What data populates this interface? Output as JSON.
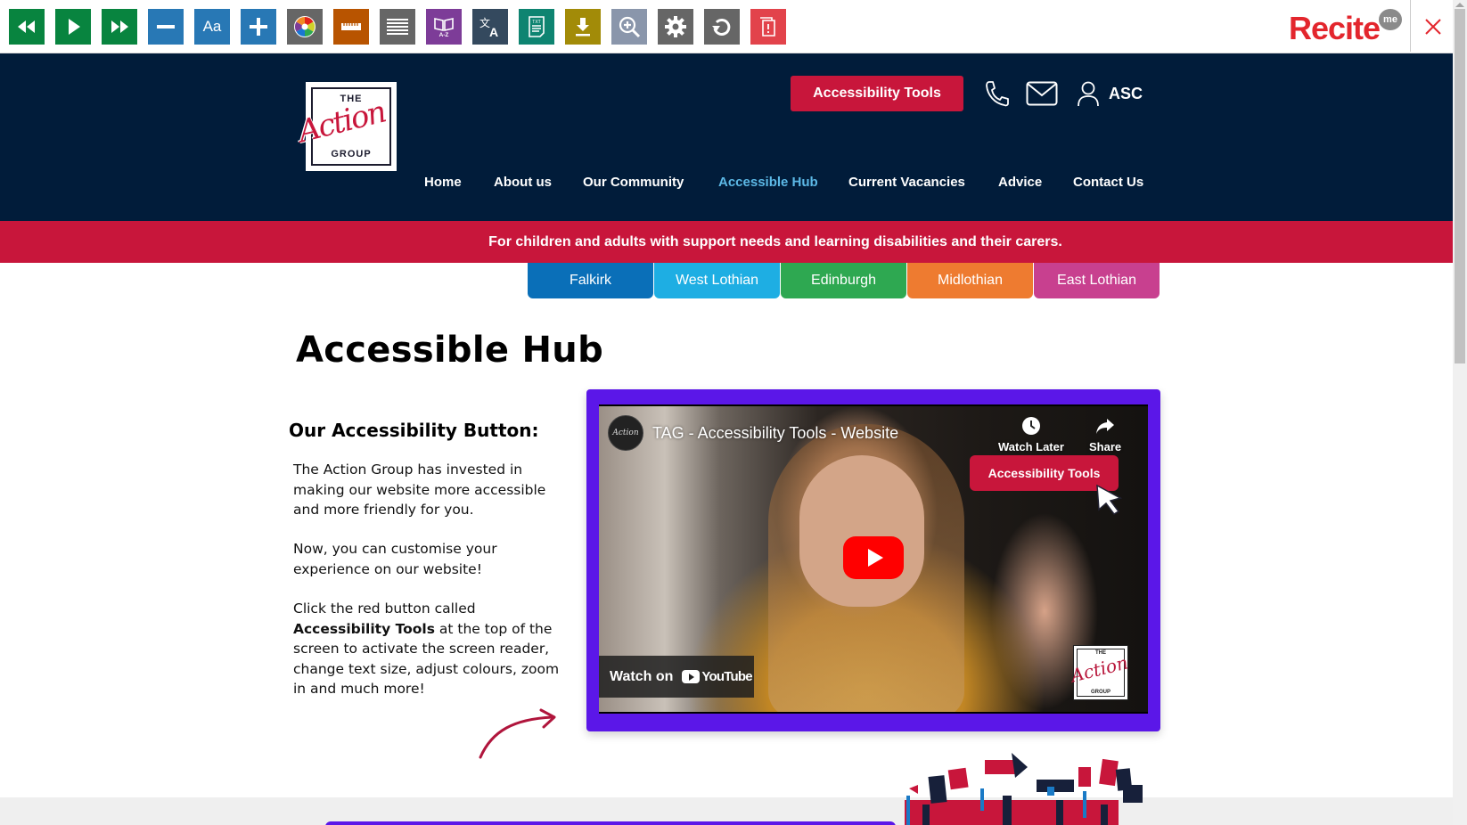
{
  "recite_toolbar": {
    "tools": [
      {
        "name": "rewind",
        "icon": "rewind-icon",
        "color": "#08843f"
      },
      {
        "name": "play",
        "icon": "play-icon",
        "color": "#08843f"
      },
      {
        "name": "fast-forward",
        "icon": "fast-forward-icon",
        "color": "#08843f"
      },
      {
        "name": "decrease-text",
        "icon": "minus-icon",
        "color": "#2878b5"
      },
      {
        "name": "font",
        "icon": "font-icon",
        "label": "Aa",
        "color": "#2878b5"
      },
      {
        "name": "increase-text",
        "icon": "plus-icon",
        "color": "#2878b5"
      },
      {
        "name": "colour",
        "icon": "colour-wheel-icon",
        "color": "#666666"
      },
      {
        "name": "ruler",
        "icon": "ruler-icon",
        "color": "#b85400"
      },
      {
        "name": "screen-mask",
        "icon": "screen-mask-icon",
        "color": "#666666"
      },
      {
        "name": "dictionary",
        "icon": "dictionary-icon",
        "label": "A-Z",
        "color": "#7d3c98"
      },
      {
        "name": "translate",
        "icon": "translate-icon",
        "color": "#34495e"
      },
      {
        "name": "text-only",
        "icon": "text-only-icon",
        "label": "TXT",
        "color": "#0e8471"
      },
      {
        "name": "download",
        "icon": "download-icon",
        "color": "#a28b08"
      },
      {
        "name": "magnifier",
        "icon": "magnifier-icon",
        "color": "#8a96ab"
      },
      {
        "name": "settings",
        "icon": "gear-icon",
        "color": "#666666"
      },
      {
        "name": "reset",
        "icon": "reset-icon",
        "color": "#666666"
      },
      {
        "name": "report",
        "icon": "report-icon",
        "color": "#e2434b"
      }
    ],
    "logo_text": "Recite",
    "logo_badge": "me",
    "close_icon": "close-icon"
  },
  "header": {
    "logo": {
      "top": "THE",
      "script": "Action",
      "bottom": "GROUP"
    },
    "accessibility_button": "Accessibility Tools",
    "phone_icon": "phone-icon",
    "mail_icon": "mail-icon",
    "user_icon": "user-icon",
    "account_label": "ASC",
    "nav": [
      {
        "label": "Home",
        "active": false
      },
      {
        "label": "About us",
        "active": false
      },
      {
        "label": "Our Community",
        "active": false
      },
      {
        "label": "Accessible Hub",
        "active": true
      },
      {
        "label": "Current Vacancies",
        "active": false
      },
      {
        "label": "Advice",
        "active": false
      },
      {
        "label": "Contact Us",
        "active": false
      }
    ]
  },
  "banner": {
    "text": "For children and adults with support needs and learning disabilities and their carers."
  },
  "regions": [
    {
      "label": "Falkirk",
      "color": "#0a6fb8"
    },
    {
      "label": "West Lothian",
      "color": "#1eaee3"
    },
    {
      "label": "Edinburgh",
      "color": "#2ea851"
    },
    {
      "label": "Midlothian",
      "color": "#ee7b30"
    },
    {
      "label": "East Lothian",
      "color": "#c8408f"
    }
  ],
  "main": {
    "title": "Accessible Hub",
    "section_heading": "Our Accessibility Button:",
    "para1": "The Action Group has invested in making our website more accessible and more friendly for you.",
    "para2": "Now, you can customise your experience on our website!",
    "para3_pre": "Click the red button called",
    "para3_bold": "Accessibility Tools",
    "para3_post": "at the top of the screen to activate the screen reader, change text size, adjust colours, zoom in and much more!"
  },
  "video": {
    "title": "TAG - Accessibility Tools - Website",
    "channel_avatar": "Action",
    "watch_later": "Watch Later",
    "share": "Share",
    "overlay_button": "Accessibility Tools",
    "watch_on": "Watch on",
    "youtube": "YouTube",
    "watermark": {
      "top": "THE",
      "script": "Action",
      "bottom": "GROUP"
    }
  },
  "colors": {
    "navy": "#011c3a",
    "brand_red": "#c8163b",
    "active_nav": "#5cb8e6",
    "video_frame": "#5b17e8"
  }
}
